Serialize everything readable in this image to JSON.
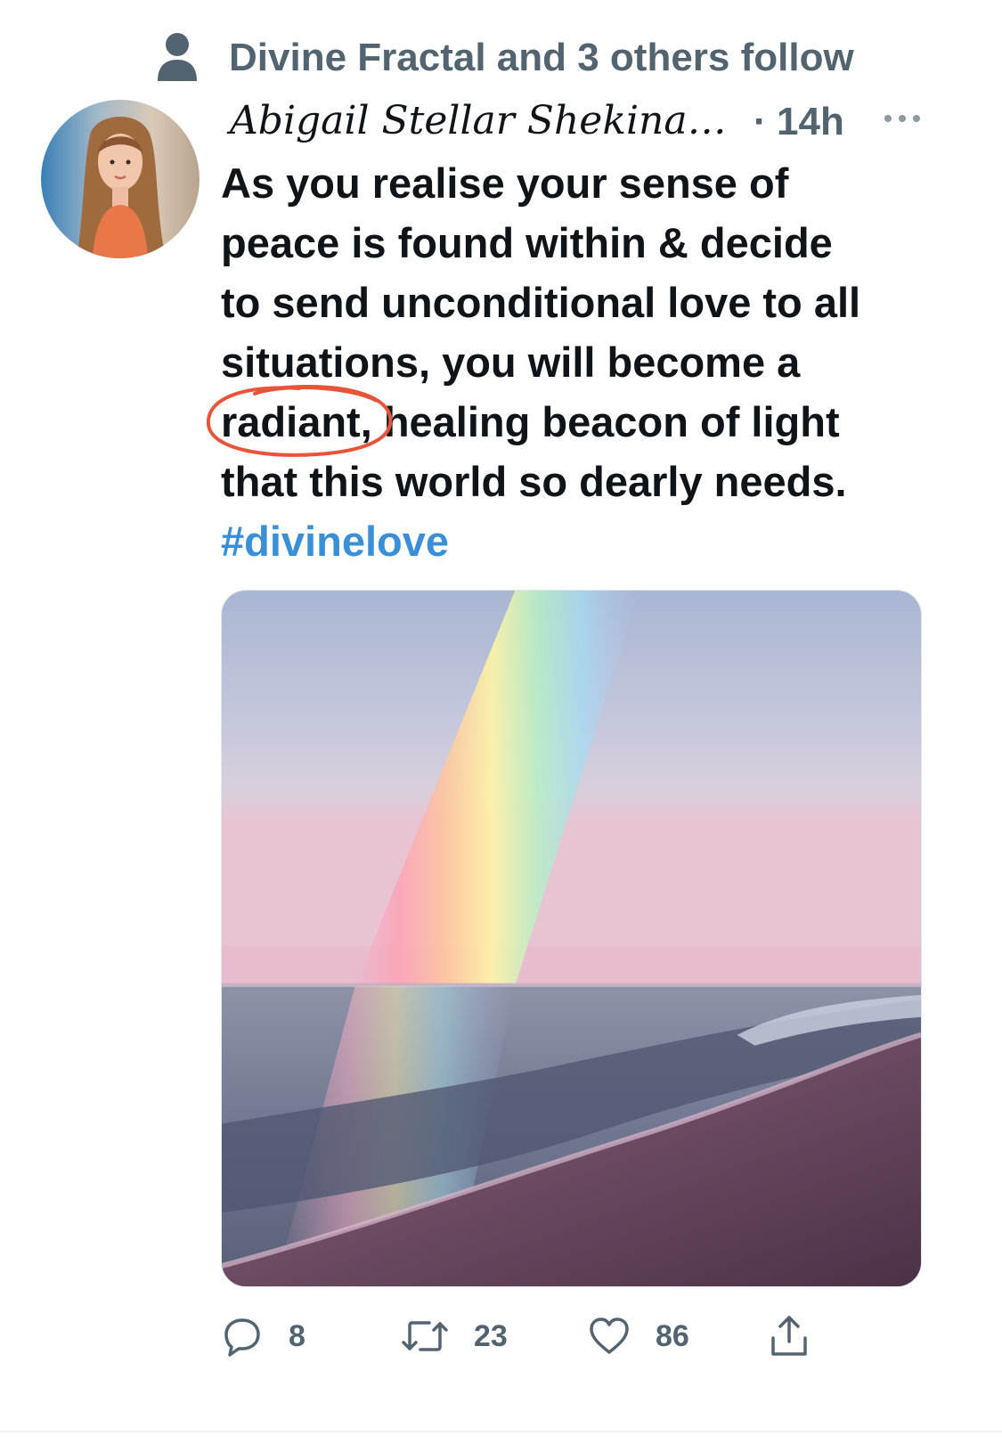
{
  "social_context": {
    "text": "Divine Fractal and 3 others follow",
    "icon": "person-icon"
  },
  "tweet": {
    "author_name": "Abigail Stellar Shekina…",
    "time_separator": "·",
    "timestamp": "14h",
    "more_icon": "more-horizontal-icon",
    "text_lines": {
      "l1": "As you realise your sense of",
      "l2": "peace is found within & decide",
      "l3": "to send unconditional love to all",
      "l4": "situations, you will become a",
      "l5_circled": "radiant,",
      "l5_rest": " healing beacon of light",
      "l6": "that this world so dearly needs.",
      "hashtag": "#divinelove"
    },
    "annotation_color": "#e8543a",
    "hashtag_color": "#3a8fd9",
    "media_description_icon": "rainbow-over-ocean-photo",
    "actions": {
      "reply": {
        "icon": "reply-icon",
        "count": "8"
      },
      "retweet": {
        "icon": "retweet-icon",
        "count": "23"
      },
      "like": {
        "icon": "heart-icon",
        "count": "86"
      },
      "share": {
        "icon": "share-icon"
      }
    }
  },
  "colors": {
    "primary_text": "#0f1419",
    "secondary_text": "#536471"
  }
}
